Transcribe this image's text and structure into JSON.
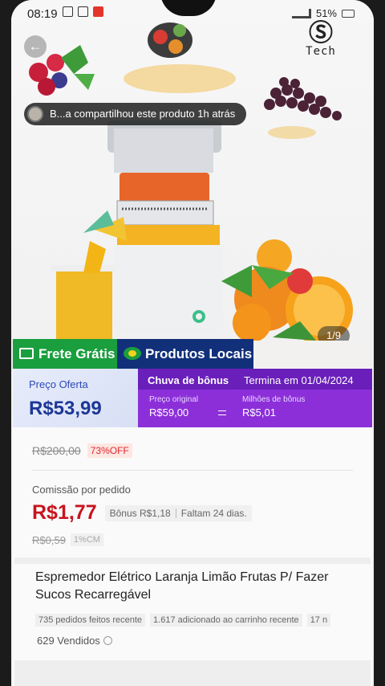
{
  "status_bar": {
    "time": "08:19",
    "battery": "51%"
  },
  "brand": {
    "word": "Tech"
  },
  "hero": {
    "share_text": "B...a compartilhou este produto 1h atrás",
    "image_counter": "1/9"
  },
  "labels": {
    "free_shipping": "Frete Grátis",
    "local_products": "Produtos Locais"
  },
  "price": {
    "offer_label": "Preço Oferta",
    "offer_value": "R$53,99",
    "bonus_title": "Chuva de bônus",
    "bonus_ends": "Termina em 01/04/2024",
    "original_label": "Preço original",
    "original_value": "R$59,00",
    "miles_label": "Milhões de bônus",
    "miles_value": "R$5,01"
  },
  "details": {
    "old_price": "R$200,00",
    "discount": "73%OFF",
    "commission_label": "Comissão por pedido",
    "commission_value": "R$1,77",
    "bonus_value": "Bônus R$1,18",
    "days_left": "Faltam 24 dias.",
    "commission_old": "R$0,59",
    "commission_pct": "1%CM",
    "title": "Espremedor Elétrico Laranja Limão Frutas P/ Fazer Sucos Recarregável",
    "stats": [
      "735 pedidos feitos recente",
      "1.617 adicionado ao carrinho recente",
      "17 n"
    ],
    "sold": "629 Vendidos"
  },
  "colors": {
    "free_green": "#1a9e3e",
    "local_blue": "#12307a",
    "bonus_purple": "#8c2fd9",
    "price_blue": "#1d3796",
    "commission_red": "#c8141e"
  }
}
